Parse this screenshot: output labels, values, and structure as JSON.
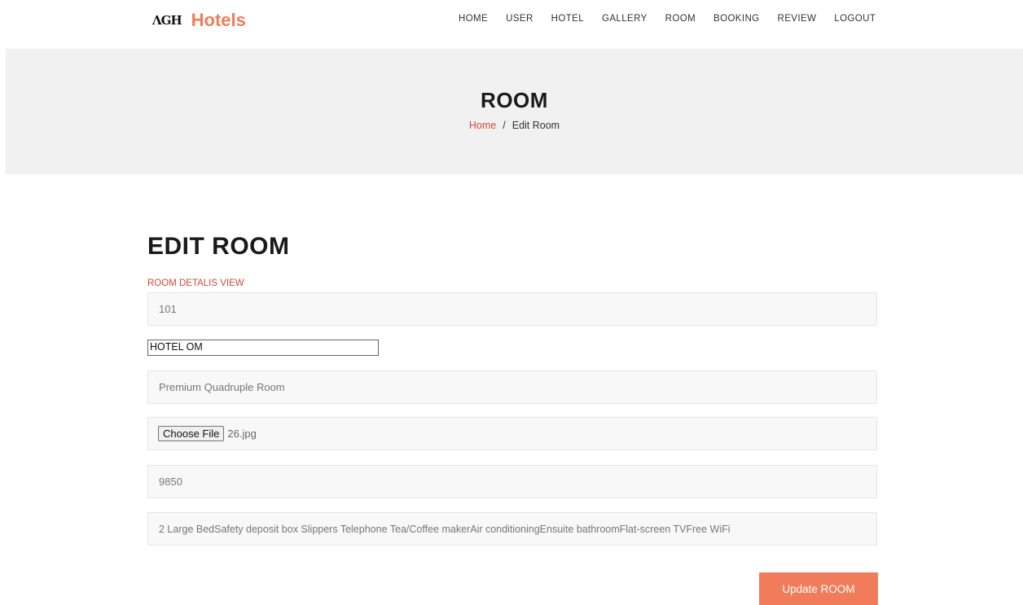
{
  "brand": {
    "mark": "ɅGH",
    "name": "Hotels"
  },
  "nav": [
    "HOME",
    "USER",
    "HOTEL",
    "GALLERY",
    "ROOM",
    "BOOKING",
    "REVIEW",
    "LOGOUT"
  ],
  "hero": {
    "title": "ROOM",
    "crumb_home": "Home",
    "crumb_sep": "/",
    "crumb_current": "Edit Room"
  },
  "form": {
    "title": "EDIT ROOM",
    "subtitle": "ROOM DETALIS VIEW",
    "room_number": "101",
    "hotel_select": "HOTEL OM",
    "room_type": "Premium Quadruple Room",
    "file_button": "Choose File",
    "file_name": "26.jpg",
    "price": "9850",
    "amenities": "2 Large BedSafety deposit box Slippers Telephone Tea/Coffee makerAir conditioningEnsuite bathroomFlat-screen TVFree WiFi",
    "submit": "Update ROOM"
  },
  "colors": {
    "accent": "#f07c5c",
    "crumb_link": "#d04a3a",
    "hero_bg": "#f1f1f1"
  }
}
